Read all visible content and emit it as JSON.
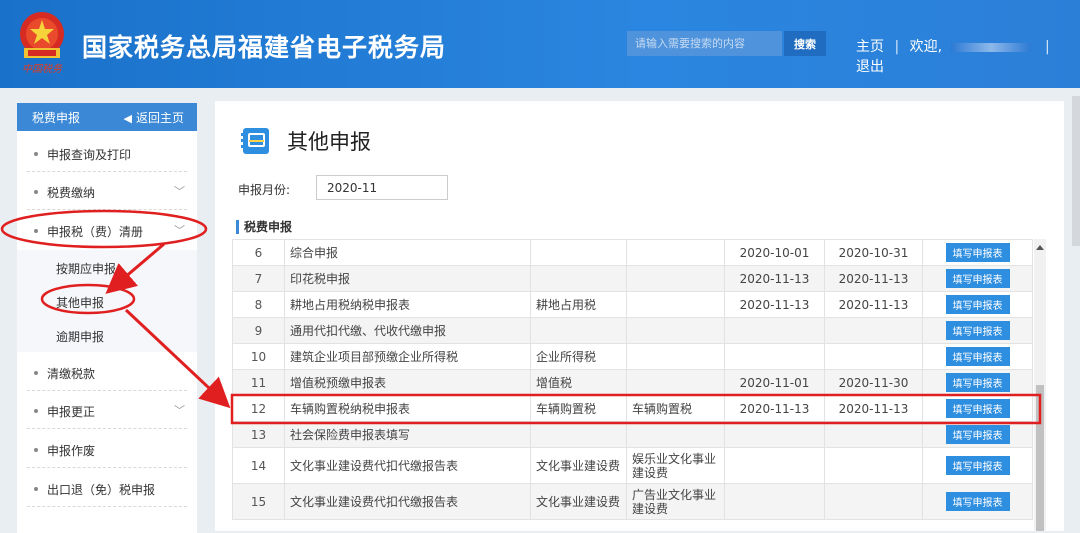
{
  "header": {
    "site_title": "国家税务总局福建省电子税务局",
    "search_placeholder": "请输入需要搜索的内容",
    "search_button": "搜索",
    "nav_home": "主页",
    "nav_sep": "|",
    "nav_welcome": "欢迎,",
    "nav_sep2": "|",
    "nav_logout": "退出"
  },
  "sidebar": {
    "title": "税费申报",
    "back_label": "返回主页",
    "items": [
      {
        "label": "申报查询及打印"
      },
      {
        "label": "税费缴纳"
      },
      {
        "label": "申报税（费）清册"
      },
      {
        "label": "清缴税款"
      },
      {
        "label": "申报更正"
      },
      {
        "label": "申报作废"
      },
      {
        "label": "出口退（免）税申报"
      }
    ],
    "sub_items": [
      {
        "label": "按期应申报"
      },
      {
        "label": "其他申报"
      },
      {
        "label": "逾期申报"
      }
    ]
  },
  "main": {
    "page_title": "其他申报",
    "month_label": "申报月份:",
    "month_value": "2020-11",
    "section_title": "税费申报",
    "rows": [
      {
        "no": "6",
        "name": "综合申报",
        "tax": "",
        "item": "",
        "start": "2020-10-01",
        "end": "2020-10-31",
        "action": "填写申报表"
      },
      {
        "no": "7",
        "name": "印花税申报",
        "tax": "",
        "item": "",
        "start": "2020-11-13",
        "end": "2020-11-13",
        "action": "填写申报表"
      },
      {
        "no": "8",
        "name": "耕地占用税纳税申报表",
        "tax": "耕地占用税",
        "item": "",
        "start": "2020-11-13",
        "end": "2020-11-13",
        "action": "填写申报表"
      },
      {
        "no": "9",
        "name": "通用代扣代缴、代收代缴申报",
        "tax": "",
        "item": "",
        "start": "",
        "end": "",
        "action": "填写申报表"
      },
      {
        "no": "10",
        "name": "建筑企业项目部预缴企业所得税",
        "tax": "企业所得税",
        "item": "",
        "start": "",
        "end": "",
        "action": "填写申报表"
      },
      {
        "no": "11",
        "name": "增值税预缴申报表",
        "tax": "增值税",
        "item": "",
        "start": "2020-11-01",
        "end": "2020-11-30",
        "action": "填写申报表"
      },
      {
        "no": "12",
        "name": "车辆购置税纳税申报表",
        "tax": "车辆购置税",
        "item": "车辆购置税",
        "start": "2020-11-13",
        "end": "2020-11-13",
        "action": "填写申报表"
      },
      {
        "no": "13",
        "name": "社会保险费申报表填写",
        "tax": "",
        "item": "",
        "start": "",
        "end": "",
        "action": "填写申报表"
      },
      {
        "no": "14",
        "name": "文化事业建设费代扣代缴报告表",
        "tax": "文化事业建设费",
        "item": "娱乐业文化事业建设费",
        "start": "",
        "end": "",
        "action": "填写申报表"
      },
      {
        "no": "15",
        "name": "文化事业建设费代扣代缴报告表",
        "tax": "文化事业建设费",
        "item": "广告业文化事业建设费",
        "start": "",
        "end": "",
        "action": "填写申报表"
      }
    ]
  },
  "colors": {
    "header_blue": "#2a86e0",
    "button_blue": "#2e8ee0",
    "annotation_red": "#e02020"
  }
}
